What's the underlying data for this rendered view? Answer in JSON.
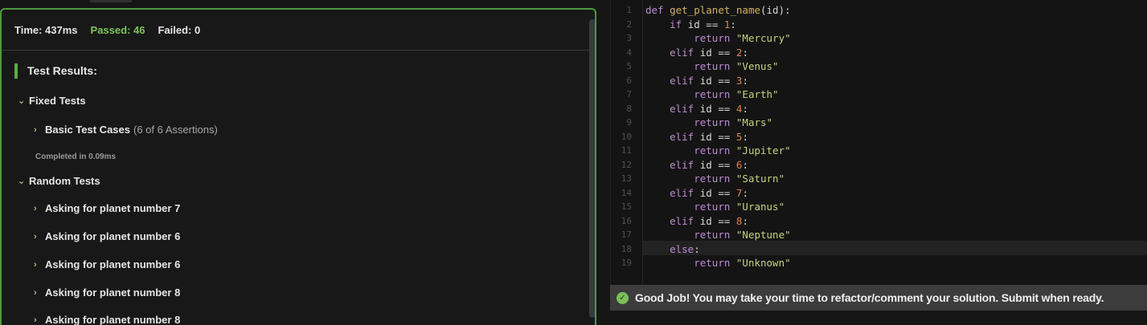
{
  "stats": {
    "time": "Time: 437ms",
    "passed": "Passed: 46",
    "failed": "Failed: 0"
  },
  "results": {
    "title": "Test Results:",
    "groups": [
      {
        "label": "Fixed Tests"
      },
      {
        "label": "Random Tests"
      }
    ],
    "fixed_items": [
      {
        "label": "Basic Test Cases",
        "assertions": "(6 of 6 Assertions)"
      }
    ],
    "completed": "Completed in 0.09ms",
    "random_items": [
      {
        "label": "Asking for planet number 7"
      },
      {
        "label": "Asking for planet number 6"
      },
      {
        "label": "Asking for planet number 6"
      },
      {
        "label": "Asking for planet number 8"
      },
      {
        "label": "Asking for planet number 8"
      }
    ]
  },
  "code": {
    "line_numbers": [
      "1",
      "2",
      "3",
      "4",
      "5",
      "6",
      "7",
      "8",
      "9",
      "10",
      "11",
      "12",
      "13",
      "14",
      "15",
      "16",
      "17",
      "18",
      "19"
    ],
    "func_name": "get_planet_name",
    "param": "id",
    "planets": [
      "\"Mercury\"",
      "\"Venus\"",
      "\"Earth\"",
      "\"Mars\"",
      "\"Jupiter\"",
      "\"Saturn\"",
      "\"Uranus\"",
      "\"Neptune\""
    ],
    "numbers": [
      "1",
      "2",
      "3",
      "4",
      "5",
      "6",
      "7",
      "8"
    ],
    "fallback": "\"Unknown\"",
    "kw_def": "def",
    "kw_if": "if",
    "kw_elif": "elif",
    "kw_else": "else",
    "kw_return": "return"
  },
  "banner": {
    "icon": "check-circle-icon",
    "text": "Good Job! You may take your time to refactor/comment your solution. Submit when ready."
  }
}
